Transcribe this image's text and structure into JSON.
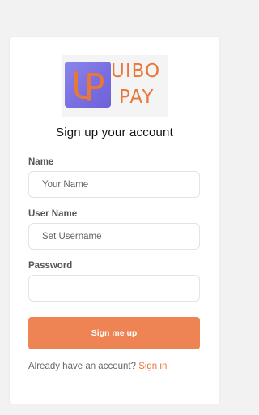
{
  "logo": {
    "icon_name": "up-logo-icon",
    "line1": "UIBO",
    "line2": "PAY",
    "text_color": "#e8773a",
    "badge_color": "#7a6fe0"
  },
  "form": {
    "title": "Sign up your account",
    "name": {
      "label": "Name",
      "placeholder": "Your Name",
      "value": ""
    },
    "username": {
      "label": "User Name",
      "placeholder": "Set Username",
      "value": ""
    },
    "password": {
      "label": "Password",
      "placeholder": "",
      "value": ""
    },
    "submit_label": "Sign me up",
    "submit_color": "#ee8454"
  },
  "footer": {
    "prompt": "Already have an account?",
    "link": "Sign in",
    "link_color": "#e8773a"
  }
}
